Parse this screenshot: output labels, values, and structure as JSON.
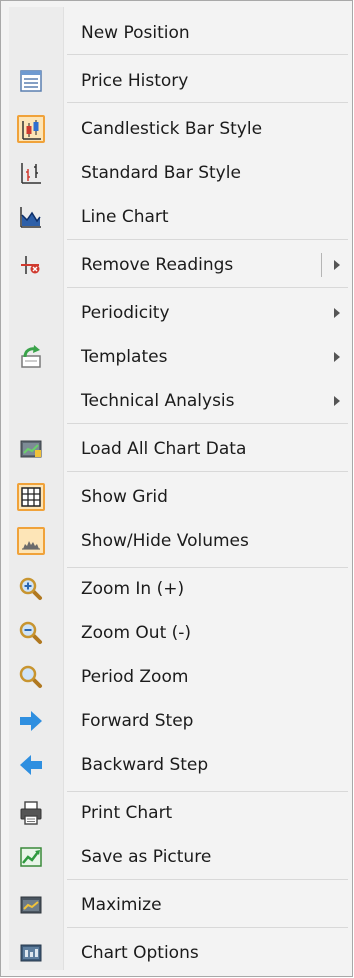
{
  "menu": {
    "items": [
      {
        "label": "New Position",
        "icon": "none"
      },
      {
        "label": "Price History",
        "icon": "list-icon"
      },
      {
        "label": "Candlestick Bar Style",
        "icon": "candlestick-icon",
        "checked": true
      },
      {
        "label": "Standard Bar Style",
        "icon": "bar-chart-icon"
      },
      {
        "label": "Line Chart",
        "icon": "line-chart-icon"
      },
      {
        "label": "Remove Readings",
        "icon": "remove-readings-icon",
        "submenu": true
      },
      {
        "label": "Periodicity",
        "icon": "none",
        "submenu": true
      },
      {
        "label": "Templates",
        "icon": "templates-icon",
        "submenu": true
      },
      {
        "label": "Technical Analysis",
        "icon": "none",
        "submenu": true
      },
      {
        "label": "Load All Chart Data",
        "icon": "load-data-icon"
      },
      {
        "label": "Show Grid",
        "icon": "grid-icon",
        "checked": true
      },
      {
        "label": "Show/Hide Volumes",
        "icon": "volumes-icon",
        "checked": true
      },
      {
        "label": "Zoom In (+)",
        "icon": "zoom-in-icon"
      },
      {
        "label": "Zoom Out (-)",
        "icon": "zoom-out-icon"
      },
      {
        "label": "Period Zoom",
        "icon": "period-zoom-icon"
      },
      {
        "label": "Forward Step",
        "icon": "forward-arrow-icon"
      },
      {
        "label": "Backward Step",
        "icon": "backward-arrow-icon"
      },
      {
        "label": "Print Chart",
        "icon": "printer-icon"
      },
      {
        "label": "Save as Picture",
        "icon": "save-picture-icon"
      },
      {
        "label": "Maximize",
        "icon": "maximize-icon"
      },
      {
        "label": "Chart Options",
        "icon": "chart-options-icon"
      }
    ]
  },
  "colors": {
    "checked_bg": "#fde5b7",
    "checked_border": "#f0a23a",
    "accent_blue": "#2f8fe0",
    "accent_red": "#d03a2f"
  }
}
